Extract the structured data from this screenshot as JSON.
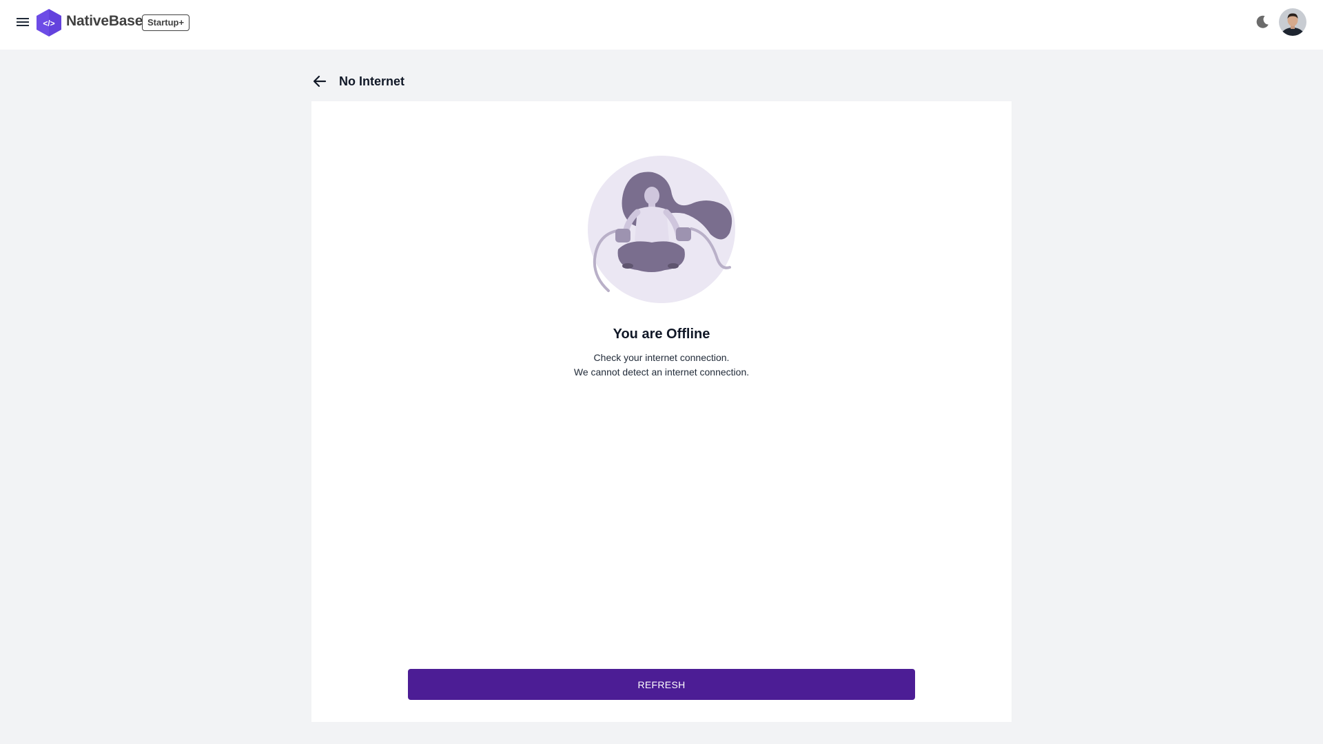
{
  "header": {
    "menu_icon": "hamburger-menu-icon",
    "logo_icon": "code-hexagon-logo",
    "brand_name": "NativeBase",
    "plan_badge": "Startup+",
    "theme_icon": "moon-icon",
    "avatar_alt": "user-avatar"
  },
  "page": {
    "back_icon": "arrow-left-icon",
    "title": "No Internet"
  },
  "content": {
    "illustration": "woman-meditating-unplugged-illustration",
    "title": "You are Offline",
    "message_line_1": "Check your internet connection.",
    "message_line_2": "We cannot detect an internet connection.",
    "refresh_label": "REFRESH"
  },
  "colors": {
    "brand_purple": "#4c1d95",
    "logo_purple": "#6d4ce6",
    "background": "#f2f3f5",
    "illustration_light": "#ebe7f3",
    "illustration_dark": "#7a6e8e"
  }
}
